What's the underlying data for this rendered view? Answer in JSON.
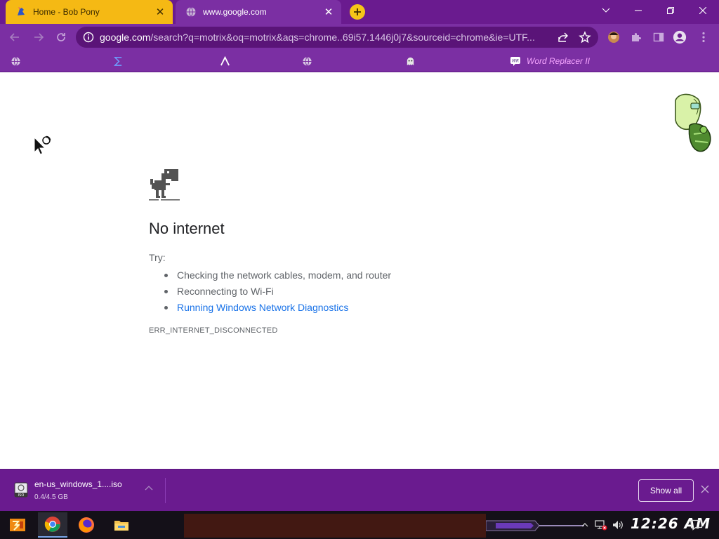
{
  "browser": {
    "tabs": [
      {
        "title": "Home - Bob Pony",
        "active": false
      },
      {
        "title": "www.google.com",
        "active": true
      }
    ],
    "omnibox": {
      "host": "google.com",
      "path": "/search?q=motrix&oq=motrix&aqs=chrome..69i57.1446j0j7&sourceid=chrome&ie=UTF..."
    },
    "bookmarks": [
      {
        "label": "",
        "icon": "globe-icon"
      },
      {
        "label": "",
        "icon": "sigma-icon"
      },
      {
        "label": "",
        "icon": "lambda-icon"
      },
      {
        "label": "",
        "icon": "globe-icon"
      },
      {
        "label": "",
        "icon": "ghost-icon"
      },
      {
        "label": "Word Replacer II",
        "icon": "wr-extension-icon"
      }
    ],
    "colors": {
      "frame": "#6a1b8f",
      "toolbar": "#7b2fa3",
      "home_tab": "#f5b914",
      "bookmark_text": "#f6a6ff"
    }
  },
  "page": {
    "title": "No internet",
    "try_label": "Try:",
    "tips": [
      "Checking the network cables, modem, and router",
      "Reconnecting to Wi-Fi",
      "Running Windows Network Diagnostics"
    ],
    "error_code": "ERR_INTERNET_DISCONNECTED"
  },
  "download": {
    "filename": "en-us_windows_1....iso",
    "progress_text": "0.4/4.5 GB",
    "progress_fraction": 0.089,
    "show_all_label": "Show all"
  },
  "taskbar": {
    "clock": "12:26 AM",
    "pinned": [
      "start-icon",
      "chrome-icon",
      "firefox-icon",
      "file-explorer-icon"
    ]
  }
}
